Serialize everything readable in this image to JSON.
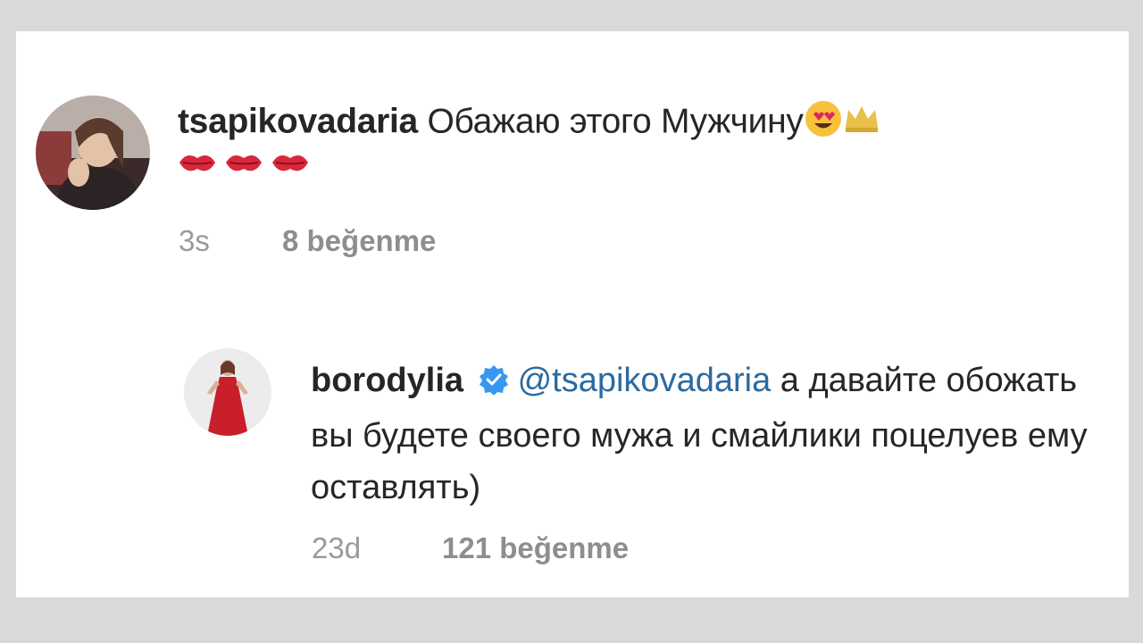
{
  "comment1": {
    "username": "tsapikovadaria",
    "text": "Обажаю этого Мужчину",
    "emojis": [
      "heart-eyes-emoji",
      "crown-emoji",
      "kiss-mark-emoji",
      "kiss-mark-emoji",
      "kiss-mark-emoji"
    ],
    "time": "3s",
    "likes": "8 beğenme"
  },
  "reply": {
    "username": "borodylia",
    "verified": true,
    "mention": "@tsapikovadaria",
    "text": " а давайте обожать вы будете своего мужа и смайлики поцелуев ему оставлять)",
    "time": "23d",
    "likes": "121 beğenme"
  },
  "colors": {
    "mention": "#2b6aa0",
    "verified_badge": "#3897f0",
    "meta_text": "#9a9a9a"
  }
}
